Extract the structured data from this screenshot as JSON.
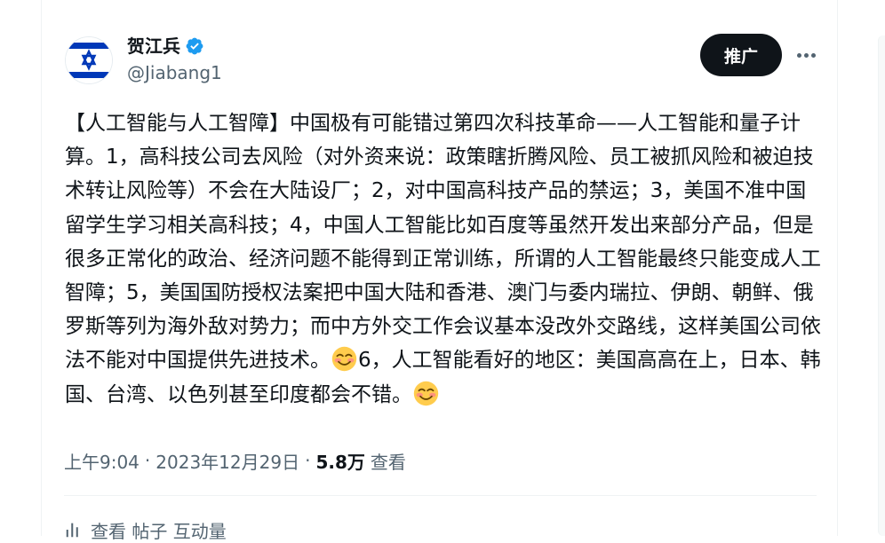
{
  "author": {
    "display_name": "贺江兵",
    "handle": "@Jiabang1",
    "verified": true,
    "avatar_icon": "israel-flag-avatar"
  },
  "actions": {
    "promote_label": "推广",
    "more_icon": "ellipsis-icon"
  },
  "tweet": {
    "text_part1": "【人工智能与人工智障】中国极有可能错过第四次科技革命——人工智能和量子计算。1，高科技公司去风险（对外资来说：政策瞎折腾风险、员工被抓风险和被迫技术转让风险等）不会在大陆设厂；2，对中国高科技产品的禁运；3，美国不准中国留学生学习相关高科技；4，中国人工智能比如百度等虽然开发出来部分产品，但是很多正常化的政治、经济问题不能得到正常训练，所谓的人工智能最终只能变成人工智障；5，美国国防授权法案把中国大陆和香港、澳门与委内瑞拉、伊朗、朝鲜、俄罗斯等列为海外敌对势力；而中方外交工作会议基本没改外交路线，这样美国公司依法不能对中国提供先进技术。",
    "text_part2": "6，人工智能看好的地区：美国高高在上，日本、韩国、台湾、以色列甚至印度都会不错。",
    "emoji_icon": "smiling-face-emoji"
  },
  "meta": {
    "time": "上午9:04",
    "date": "2023年12月29日",
    "separator": "·",
    "views_count": "5.8万",
    "views_label": "查看"
  },
  "engagement": {
    "label": "查看 帖子 互动量",
    "icon": "analytics-icon"
  },
  "colors": {
    "text_primary": "#0f1419",
    "text_secondary": "#536471",
    "verified_blue": "#1d9bf0",
    "flag_blue": "#0038b8",
    "divider": "#eff3f4"
  }
}
